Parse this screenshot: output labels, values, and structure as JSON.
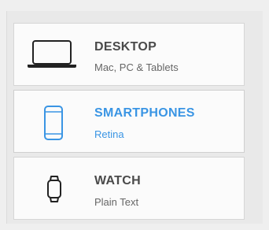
{
  "options": [
    {
      "title": "DESKTOP",
      "subtitle": "Mac, PC & Tablets",
      "icon": "laptop-icon",
      "selected": false
    },
    {
      "title": "SMARTPHONES",
      "subtitle": "Retina",
      "icon": "smartphone-icon",
      "selected": true
    },
    {
      "title": "WATCH",
      "subtitle": "Plain Text",
      "icon": "watch-icon",
      "selected": false
    }
  ],
  "colors": {
    "accent": "#3a95e4",
    "text": "#4a4a4a",
    "subtext": "#666666",
    "card": "#fbfbfb",
    "border": "#d6d6d6"
  }
}
